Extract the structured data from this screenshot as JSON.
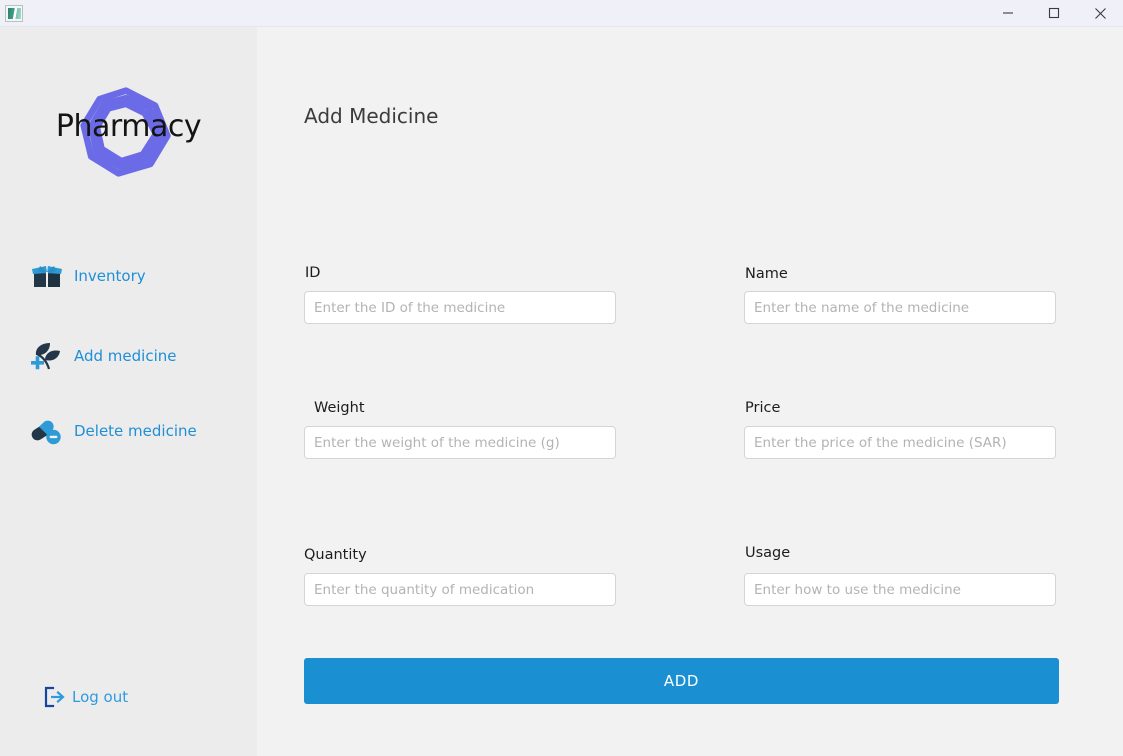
{
  "window": {
    "app_icon": "app-window-icon",
    "minimize_label": "Minimize",
    "maximize_label": "Maximize",
    "close_label": "Close"
  },
  "sidebar": {
    "logo": {
      "text": "Pharmacy",
      "icon": "woven-ring-logo",
      "color": "#6b6be8"
    },
    "items": [
      {
        "label": "Inventory",
        "icon": "open-box-icon"
      },
      {
        "label": "Add medicine",
        "icon": "plant-plus-icon"
      },
      {
        "label": "Delete medicine",
        "icon": "pills-minus-icon"
      }
    ],
    "logout": {
      "label": "Log out",
      "icon": "logout-door-arrow-icon"
    },
    "link_color": "#1f8fd6",
    "background": "#ececec"
  },
  "main": {
    "title": "Add Medicine",
    "fields": [
      {
        "label": "ID",
        "value": "",
        "placeholder": "Enter the ID of the medicine"
      },
      {
        "label": "Name",
        "value": "",
        "placeholder": "Enter the name of the medicine"
      },
      {
        "label": "Weight",
        "value": "",
        "placeholder": "Enter the weight of the medicine (g)"
      },
      {
        "label": "Price",
        "value": "",
        "placeholder": "Enter the price of the medicine (SAR)"
      },
      {
        "label": "Quantity",
        "value": "",
        "placeholder": "Enter the quantity of medication"
      },
      {
        "label": "Usage",
        "value": "",
        "placeholder": "Enter how to use the medicine"
      }
    ],
    "submit": {
      "label": "ADD",
      "color": "#1a8fd1"
    }
  }
}
